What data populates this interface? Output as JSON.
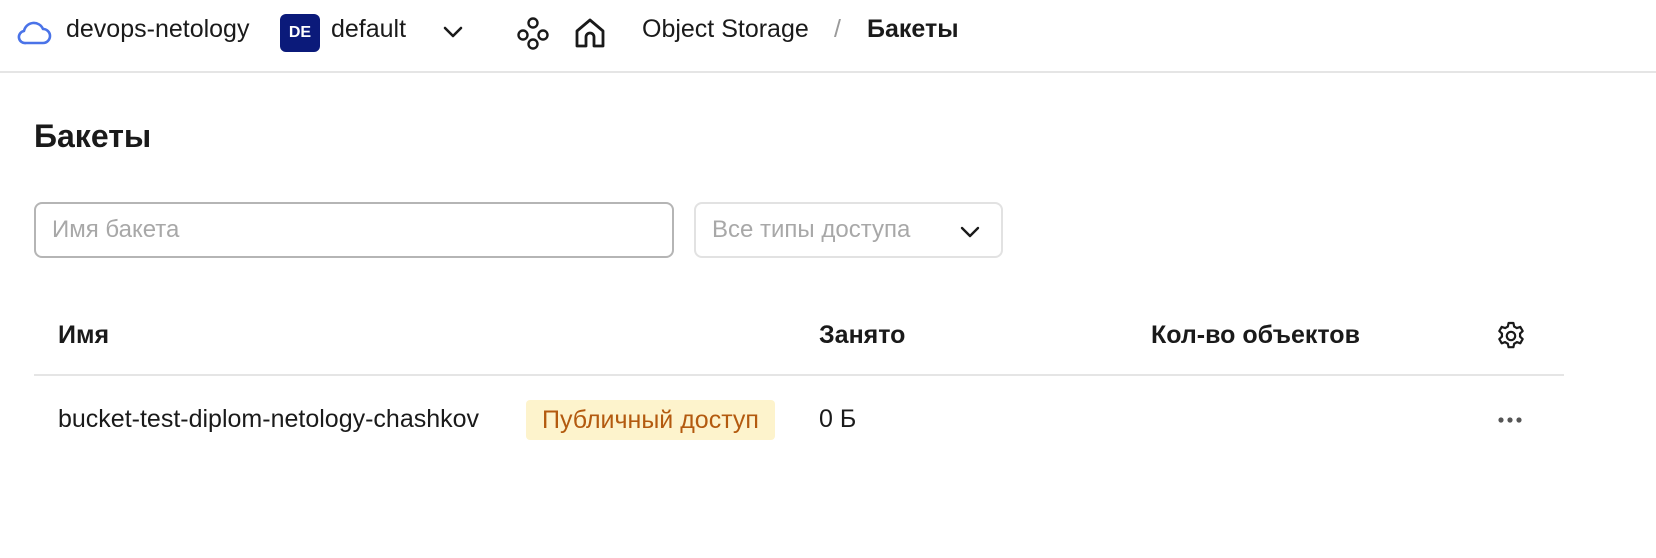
{
  "header": {
    "cloud_name": "devops-netology",
    "folder_badge": "DE",
    "folder_name": "default",
    "breadcrumb": {
      "service": "Object Storage",
      "separator": "/",
      "current": "Бакеты"
    },
    "icons": [
      "cloud-icon",
      "chevron-down-icon",
      "services-icon",
      "home-icon"
    ]
  },
  "page": {
    "title": "Бакеты"
  },
  "filters": {
    "search_placeholder": "Имя бакета",
    "search_value": "",
    "access_select_value": "Все типы доступа"
  },
  "table": {
    "columns": [
      "Имя",
      "Занято",
      "Кол-во объектов"
    ],
    "rows": [
      {
        "name": "bucket-test-diplom-netology-chashkov",
        "badge": "Публичный доступ",
        "size": "0 Б",
        "count": ""
      }
    ]
  },
  "colors": {
    "accent": "#4a73e8",
    "folder_badge_bg": "#0b1a7a",
    "public_badge_bg": "#fdf3cc",
    "public_badge_text": "#b35a0f"
  }
}
